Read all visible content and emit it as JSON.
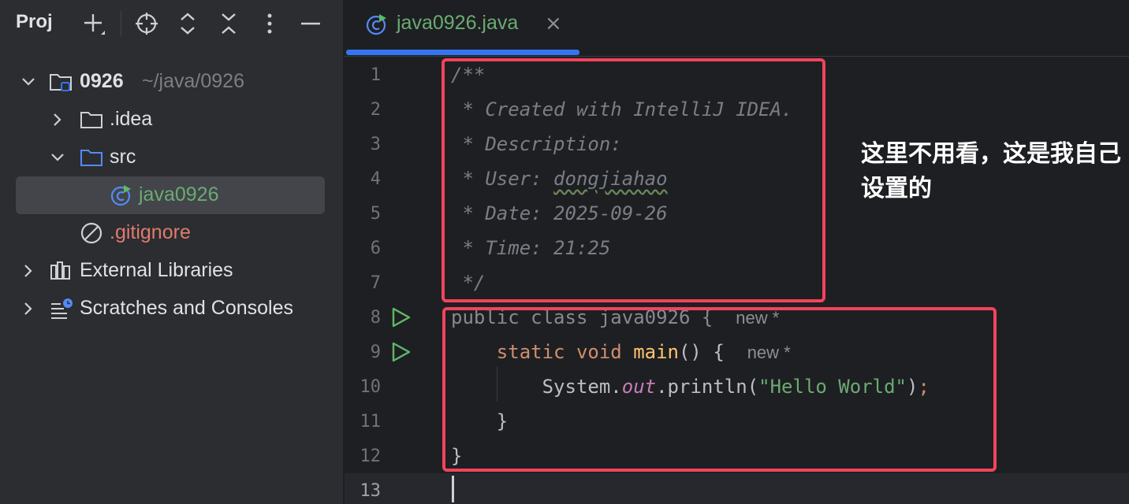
{
  "panel": {
    "title": "Proj"
  },
  "tree": {
    "root": {
      "name": "0926",
      "path": "~/java/0926"
    },
    "idea": ".idea",
    "src": "src",
    "java_file": "java0926",
    "gitignore": ".gitignore",
    "external_libraries": "External Libraries",
    "scratches": "Scratches and Consoles"
  },
  "editor": {
    "tab_label": "java0926.java",
    "tab_close": "×",
    "line_numbers": [
      "1",
      "2",
      "3",
      "4",
      "5",
      "6",
      "7",
      "8",
      "9",
      "10",
      "11",
      "12",
      "13"
    ],
    "code": {
      "l1": "/**",
      "l2": " * Created with IntelliJ IDEA.",
      "l3": " * Description:",
      "l4_prefix": " * User: ",
      "l4_user": "dongjiahao",
      "l5": " * Date: 2025-09-26",
      "l6": " * Time: 21:25",
      "l7": " */",
      "l8_kw": "public class ",
      "l8_name": "java0926 {",
      "l9_kw": "    static void ",
      "l9_name": "main",
      "l9_rest": "() {",
      "l10_a": "        System.",
      "l10_b": "out",
      "l10_c": ".println(",
      "l10_str": "\"Hello World\"",
      "l10_d": ")",
      "l10_semi": ";",
      "l11": "    }",
      "l12": "}",
      "hint_new": "new *"
    }
  },
  "annotation": {
    "text": "这里不用看，这是我自己设置的"
  },
  "colors": {
    "accent": "#3574f0",
    "annotation_border": "#f2445c",
    "run_icon": "#5fb865"
  }
}
